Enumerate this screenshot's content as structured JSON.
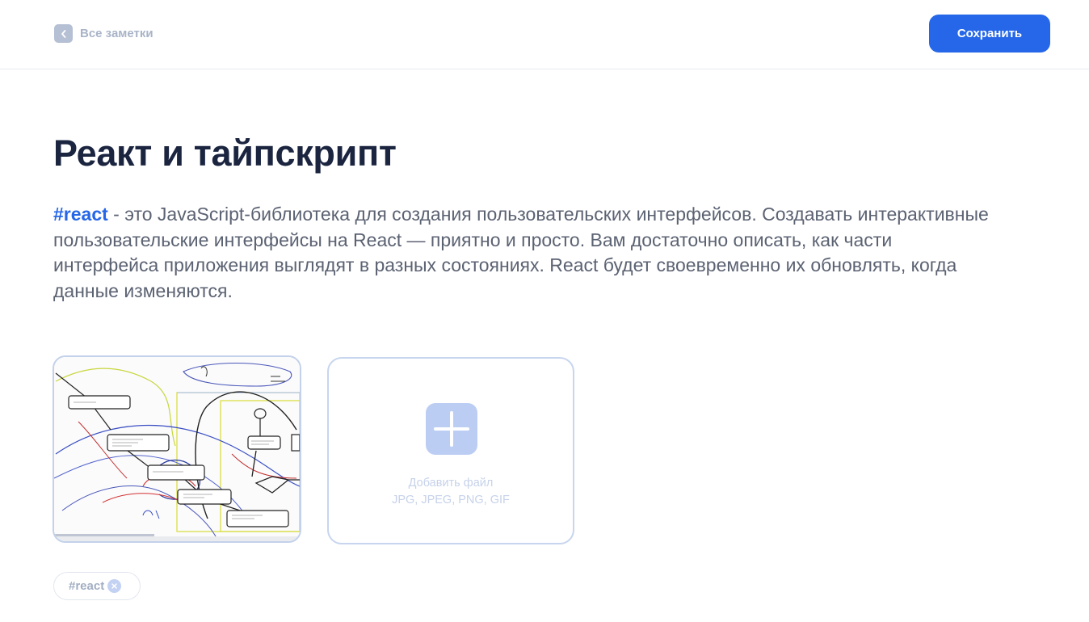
{
  "header": {
    "back_label": "Все заметки",
    "back_icon": "chevron-left-icon",
    "save_label": "Сохранить"
  },
  "note": {
    "title": "Реакт и тайпскрипт",
    "hashtag": "#react",
    "body_text": " - это JavaScript-библиотека для создания пользовательских интерфейсов. Создавать интерактивные пользовательские интерфейсы на React — приятно и просто. Вам достаточно описать, как части интерфейса приложения выглядят в разных состояниях. React будет своевременно их обновлять, когда данные изменяются."
  },
  "attachments": {
    "upload_icon": "plus-icon",
    "upload_title": "Добавить файл",
    "upload_formats": "JPG, JPEG, PNG, GIF"
  },
  "tags": [
    {
      "label": "#react",
      "remove_icon": "close-icon"
    }
  ],
  "colors": {
    "accent": "#2567e8",
    "title": "#1b2540",
    "body": "#5b6272",
    "muted": "#a9b4c8"
  }
}
